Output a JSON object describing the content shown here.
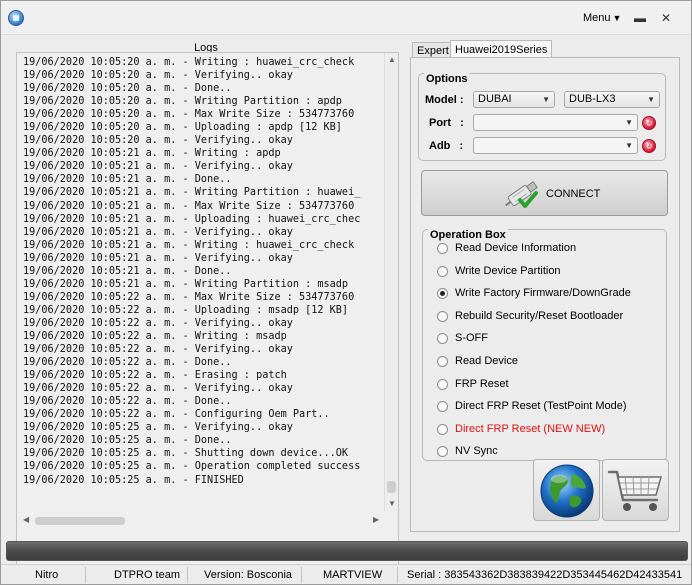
{
  "titlebar": {
    "menu_label": "Menu",
    "minimize_glyph": "▬",
    "close_glyph": "✕"
  },
  "logs": {
    "title": "Logs",
    "lines": [
      "19/06/2020 10:05:20 a. m. - Writing : huawei_crc_check",
      "19/06/2020 10:05:20 a. m. - Verifying.. okay",
      "19/06/2020 10:05:20 a. m. - Done..",
      "19/06/2020 10:05:20 a. m. - Writing Partition : apdp",
      "19/06/2020 10:05:20 a. m. - Max Write Size : 534773760",
      "19/06/2020 10:05:20 a. m. - Uploading : apdp [12 KB]",
      "19/06/2020 10:05:20 a. m. - Verifying.. okay",
      "19/06/2020 10:05:21 a. m. - Writing : apdp",
      "19/06/2020 10:05:21 a. m. - Verifying.. okay",
      "19/06/2020 10:05:21 a. m. - Done..",
      "19/06/2020 10:05:21 a. m. - Writing Partition : huawei_",
      "19/06/2020 10:05:21 a. m. - Max Write Size : 534773760",
      "19/06/2020 10:05:21 a. m. - Uploading : huawei_crc_chec",
      "19/06/2020 10:05:21 a. m. - Verifying.. okay",
      "19/06/2020 10:05:21 a. m. - Writing : huawei_crc_check",
      "19/06/2020 10:05:21 a. m. - Verifying.. okay",
      "19/06/2020 10:05:21 a. m. - Done..",
      "19/06/2020 10:05:21 a. m. - Writing Partition : msadp",
      "19/06/2020 10:05:22 a. m. - Max Write Size : 534773760",
      "19/06/2020 10:05:22 a. m. - Uploading : msadp [12 KB]",
      "19/06/2020 10:05:22 a. m. - Verifying.. okay",
      "19/06/2020 10:05:22 a. m. - Writing : msadp",
      "19/06/2020 10:05:22 a. m. - Verifying.. okay",
      "19/06/2020 10:05:22 a. m. - Done..",
      "19/06/2020 10:05:22 a. m. - Erasing : patch",
      "19/06/2020 10:05:22 a. m. - Verifying.. okay",
      "19/06/2020 10:05:22 a. m. - Done..",
      "19/06/2020 10:05:22 a. m. - Configuring Oem Part..",
      "19/06/2020 10:05:25 a. m. - Verifying.. okay",
      "19/06/2020 10:05:25 a. m. - Done..",
      "19/06/2020 10:05:25 a. m. - Shutting down device...OK",
      "19/06/2020 10:05:25 a. m. - Operation completed success",
      "19/06/2020 10:05:25 a. m. - FINISHED"
    ]
  },
  "tabs": [
    {
      "label": "Expert"
    },
    {
      "label": "Huawei2019Series"
    }
  ],
  "options": {
    "title": "Options",
    "model_label": "Model",
    "model_value": "DUBAI",
    "variant_value": "DUB-LX3",
    "port_label": "Port",
    "port_value": "",
    "adb_label": "Adb",
    "adb_value": ""
  },
  "connect": {
    "label": "CONNECT"
  },
  "operation_box": {
    "title": "Operation Box",
    "items": [
      {
        "label": "Read Device Information",
        "checked": false,
        "color": "#000000"
      },
      {
        "label": "Write Device Partition",
        "checked": false,
        "color": "#000000"
      },
      {
        "label": "Write Factory Firmware/DownGrade",
        "checked": true,
        "color": "#000000"
      },
      {
        "label": "Rebuild Security/Reset Bootloader",
        "checked": false,
        "color": "#000000"
      },
      {
        "label": "S-OFF",
        "checked": false,
        "color": "#000000"
      },
      {
        "label": "Read Device",
        "checked": false,
        "color": "#000000"
      },
      {
        "label": "FRP Reset",
        "checked": false,
        "color": "#000000"
      },
      {
        "label": "Direct FRP Reset (TestPoint Mode)",
        "checked": false,
        "color": "#000000"
      },
      {
        "label": "Direct FRP Reset (NEW NEW)",
        "checked": false,
        "color": "#e01010"
      },
      {
        "label": "NV Sync",
        "checked": false,
        "color": "#000000"
      }
    ]
  },
  "tiles": {
    "globe_icon": "globe-icon",
    "cart_icon": "shopping-cart-icon"
  },
  "progress": {
    "fraction": 0
  },
  "status": {
    "nitro": "Nitro",
    "team": "DTPRO team",
    "version": "Version: Bosconia",
    "brand": "MARTVIEW",
    "serial": "Serial : 383543362D383839422D353445462D42433541"
  },
  "colors": {
    "accent_red": "#e01010",
    "progress_bg": "#4a4a4a"
  }
}
